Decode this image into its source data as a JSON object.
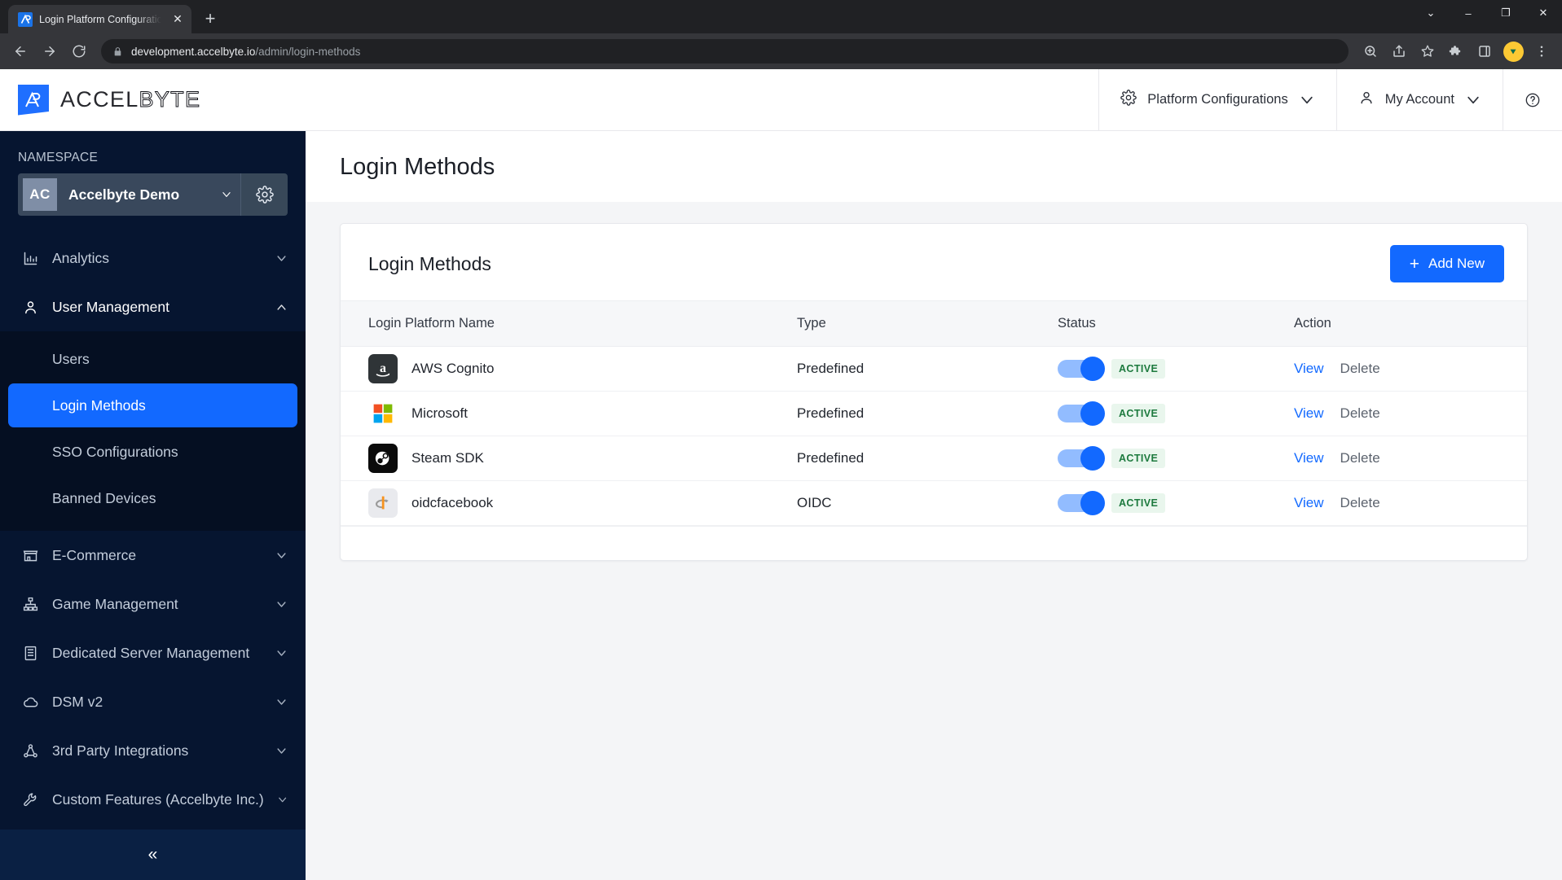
{
  "browser": {
    "tab": {
      "title": "Login Platform Configuration | Ac",
      "favicon": "accelbyte-favicon",
      "close_label": "✕"
    },
    "new_tab_label": "+",
    "window_controls": {
      "minimize": "–",
      "maximize": "❐",
      "close": "✕",
      "tab_search": "⌄"
    },
    "nav": {
      "back": "back-icon",
      "forward": "forward-icon",
      "reload": "reload-icon"
    },
    "url": {
      "host": "development.accelbyte.io",
      "path": "/admin/login-methods",
      "lock": "lock-icon"
    },
    "toolbar_icons": [
      "zoom-icon",
      "share-icon",
      "bookmark-star-icon",
      "extensions-puzzle-icon",
      "side-panel-icon",
      "profile-avatar-icon",
      "chrome-menu-icon"
    ]
  },
  "header": {
    "logo_accel": "ACCEL",
    "logo_byte": "BYTE",
    "platform_configurations": "Platform Configurations",
    "my_account": "My Account",
    "help": "?"
  },
  "sidebar": {
    "namespace_label": "NAMESPACE",
    "namespace": {
      "initials": "AC",
      "name": "Accelbyte Demo"
    },
    "items": [
      {
        "label": "Analytics",
        "icon": "chart-bar-icon",
        "caret": "down",
        "expanded": false
      },
      {
        "label": "User Management",
        "icon": "user-icon",
        "caret": "up",
        "expanded": true
      },
      {
        "label": "E-Commerce",
        "icon": "store-icon",
        "caret": "down",
        "expanded": false
      },
      {
        "label": "Game Management",
        "icon": "sitemap-icon",
        "caret": "down",
        "expanded": false
      },
      {
        "label": "Dedicated Server Management",
        "icon": "server-icon",
        "caret": "down",
        "expanded": false
      },
      {
        "label": "DSM v2",
        "icon": "cloud-icon",
        "caret": "down",
        "expanded": false
      },
      {
        "label": "3rd Party Integrations",
        "icon": "network-nodes-icon",
        "caret": "down",
        "expanded": false
      },
      {
        "label": "Custom Features (Accelbyte Inc.)",
        "icon": "wrench-icon",
        "caret": "down",
        "expanded": false
      }
    ],
    "submenu": [
      {
        "label": "Users",
        "active": false
      },
      {
        "label": "Login Methods",
        "active": true
      },
      {
        "label": "SSO Configurations",
        "active": false
      },
      {
        "label": "Banned Devices",
        "active": false
      }
    ],
    "collapse_label": "«"
  },
  "main": {
    "page_title": "Login Methods",
    "card_title": "Login Methods",
    "add_new_label": "Add New",
    "add_new_plus": "+",
    "columns": [
      "Login Platform Name",
      "Type",
      "Status",
      "Action"
    ],
    "rows": [
      {
        "name": "AWS Cognito",
        "icon": "amazon-aws-icon",
        "type": "Predefined",
        "status_on": true,
        "status_label": "ACTIVE",
        "view": "View",
        "delete": "Delete"
      },
      {
        "name": "Microsoft",
        "icon": "microsoft-icon",
        "type": "Predefined",
        "status_on": true,
        "status_label": "ACTIVE",
        "view": "View",
        "delete": "Delete"
      },
      {
        "name": "Steam SDK",
        "icon": "steam-icon",
        "type": "Predefined",
        "status_on": true,
        "status_label": "ACTIVE",
        "view": "View",
        "delete": "Delete"
      },
      {
        "name": "oidcfacebook",
        "icon": "openid-connect-icon",
        "type": "OIDC",
        "status_on": true,
        "status_label": "ACTIVE",
        "view": "View",
        "delete": "Delete"
      }
    ]
  },
  "colors": {
    "accent_blue": "#1269ff",
    "sidebar_bg": "#061530",
    "sidebar_sub_bg": "#050f22",
    "badge_green_text": "#1d7a3e",
    "badge_green_bg": "#e9f6ed",
    "page_bg": "#f4f5f7"
  }
}
